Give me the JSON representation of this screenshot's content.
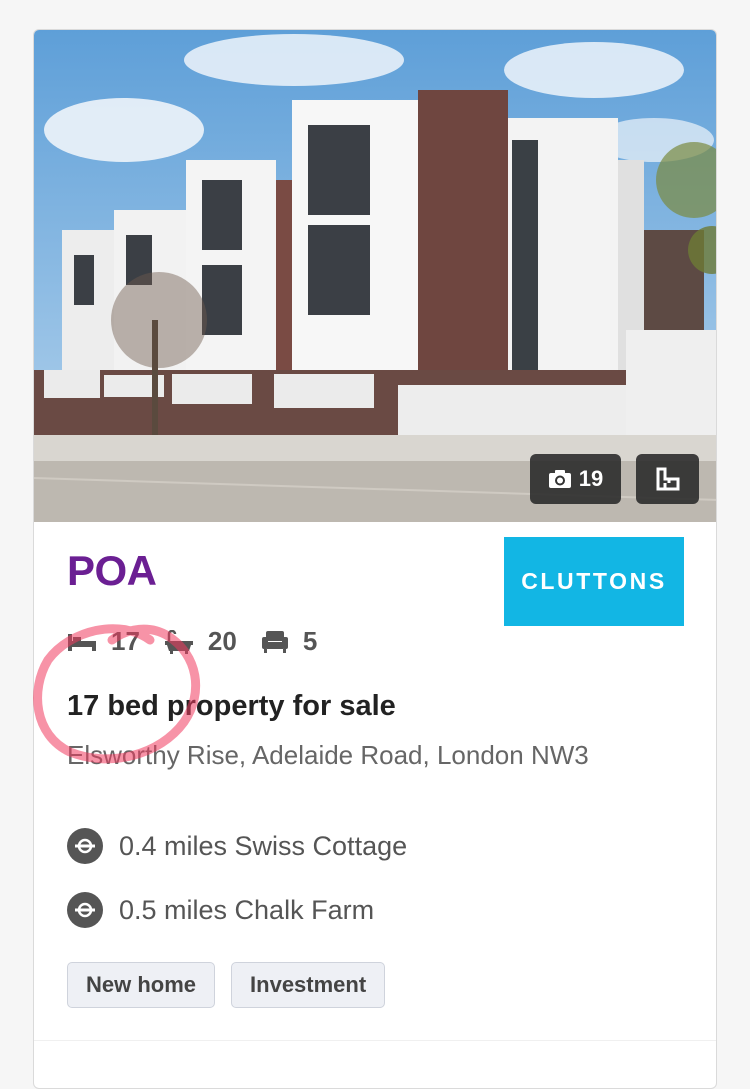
{
  "listing": {
    "price": "POA",
    "agent_name": "CLUTTONS",
    "photo_count": "19",
    "bedrooms": "17",
    "bathrooms": "20",
    "receptions": "5",
    "title": "17 bed property for sale",
    "address": "Elsworthy Rise, Adelaide Road, London NW3",
    "stations": [
      {
        "label": "0.4 miles Swiss Cottage"
      },
      {
        "label": "0.5 miles Chalk Farm"
      }
    ],
    "tags": [
      "New home",
      "Investment"
    ]
  },
  "icons": {
    "photo_pill": "camera-icon",
    "floorplan": "floorplan-icon",
    "bed": "bed-icon",
    "bath": "bath-icon",
    "reception": "armchair-icon",
    "station": "underground-icon"
  },
  "colors": {
    "price": "#6b1f93",
    "agent_brand": "#12b6e4",
    "annotation": "#f03a5f"
  }
}
